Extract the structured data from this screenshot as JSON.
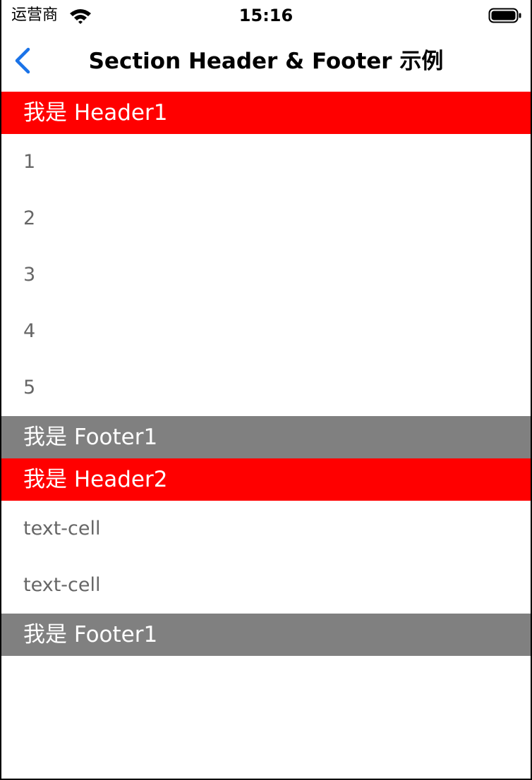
{
  "status_bar": {
    "carrier": "运营商",
    "time": "15:16",
    "icons": [
      "wifi-icon",
      "battery-icon"
    ]
  },
  "nav_bar": {
    "title": "Section Header & Footer 示例",
    "back_icon": "chevron-left-icon"
  },
  "colors": {
    "header_bg": "#ff0000",
    "footer_bg": "#808080",
    "accent": "#1a73e8",
    "cell_text": "#666666"
  },
  "sections": [
    {
      "header": "我是 Header1",
      "cells": [
        "1",
        "2",
        "3",
        "4",
        "5"
      ],
      "footer": "我是 Footer1"
    },
    {
      "header": "我是 Header2",
      "cells": [
        "text-cell",
        "text-cell"
      ],
      "footer": "我是 Footer1"
    }
  ]
}
